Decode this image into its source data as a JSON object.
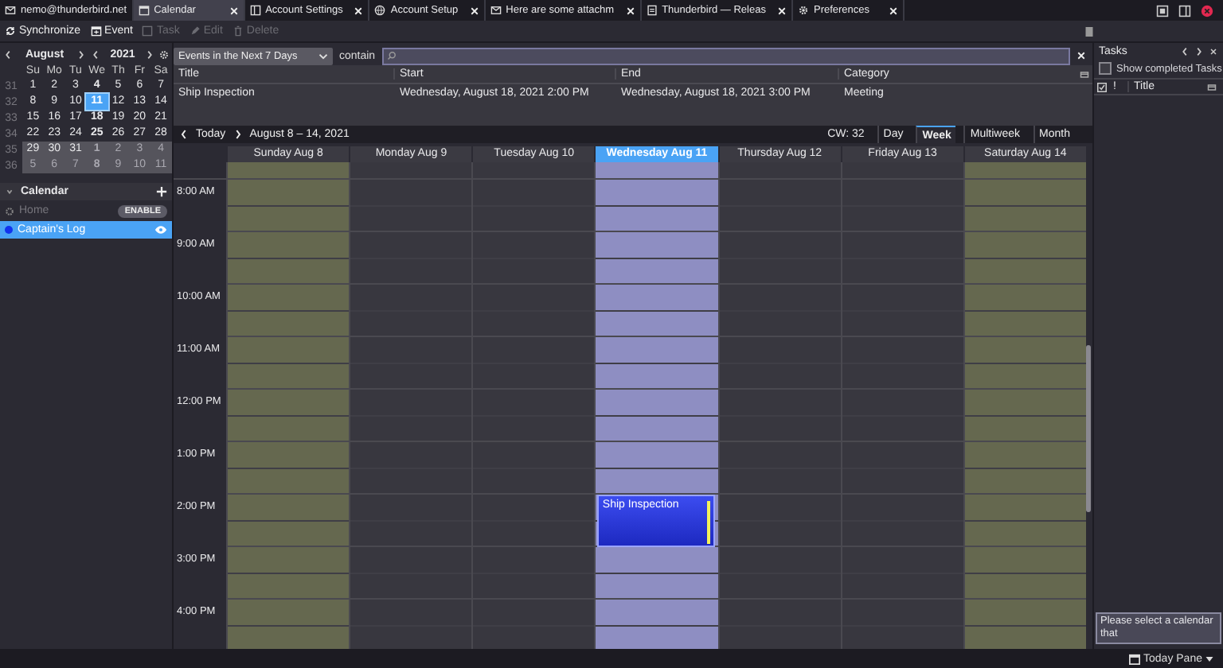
{
  "tabs": [
    {
      "label": "nemo@thunderbird.net",
      "kind": "mail",
      "selected": false,
      "closable": false
    },
    {
      "label": "Calendar",
      "kind": "calendar",
      "selected": true,
      "closable": true
    },
    {
      "label": "Account Settings",
      "kind": "panel",
      "selected": false,
      "closable": true
    },
    {
      "label": "Account Setup",
      "kind": "globe",
      "selected": false,
      "closable": true
    },
    {
      "label": "Here are some attachm",
      "kind": "mail",
      "selected": false,
      "closable": true
    },
    {
      "label": "Thunderbird — Releas",
      "kind": "document",
      "selected": false,
      "closable": true
    },
    {
      "label": "Preferences",
      "kind": "gear",
      "selected": false,
      "closable": true
    }
  ],
  "toolbar": [
    {
      "label": "Synchronize",
      "kind": "sync",
      "disabled": false
    },
    {
      "label": "Event",
      "kind": "calendar",
      "disabled": false
    },
    {
      "label": "Task",
      "kind": "task",
      "disabled": true
    },
    {
      "label": "Edit",
      "kind": "pencil",
      "disabled": true
    },
    {
      "label": "Delete",
      "kind": "trash",
      "disabled": true
    }
  ],
  "minimonth": {
    "month": "August",
    "year": "2021",
    "weekdays": [
      "Su",
      "Mo",
      "Tu",
      "We",
      "Th",
      "Fr",
      "Sa"
    ],
    "weeks": [
      {
        "number": "31",
        "shaded": false,
        "days": [
          {
            "label": "1",
            "other_month": false,
            "has_events": false,
            "selected": false
          },
          {
            "label": "2",
            "other_month": false,
            "has_events": false,
            "selected": false
          },
          {
            "label": "3",
            "other_month": false,
            "has_events": false,
            "selected": false
          },
          {
            "label": "4",
            "other_month": false,
            "has_events": true,
            "selected": false
          },
          {
            "label": "5",
            "other_month": false,
            "has_events": false,
            "selected": false
          },
          {
            "label": "6",
            "other_month": false,
            "has_events": false,
            "selected": false
          },
          {
            "label": "7",
            "other_month": false,
            "has_events": false,
            "selected": false
          }
        ]
      },
      {
        "number": "32",
        "shaded": false,
        "days": [
          {
            "label": "8",
            "other_month": false,
            "has_events": false,
            "selected": false
          },
          {
            "label": "9",
            "other_month": false,
            "has_events": false,
            "selected": false
          },
          {
            "label": "10",
            "other_month": false,
            "has_events": false,
            "selected": false
          },
          {
            "label": "11",
            "other_month": false,
            "has_events": true,
            "selected": true
          },
          {
            "label": "12",
            "other_month": false,
            "has_events": false,
            "selected": false
          },
          {
            "label": "13",
            "other_month": false,
            "has_events": false,
            "selected": false
          },
          {
            "label": "14",
            "other_month": false,
            "has_events": false,
            "selected": false
          }
        ]
      },
      {
        "number": "33",
        "shaded": false,
        "days": [
          {
            "label": "15",
            "other_month": false,
            "has_events": false,
            "selected": false
          },
          {
            "label": "16",
            "other_month": false,
            "has_events": false,
            "selected": false
          },
          {
            "label": "17",
            "other_month": false,
            "has_events": false,
            "selected": false
          },
          {
            "label": "18",
            "other_month": false,
            "has_events": true,
            "selected": false
          },
          {
            "label": "19",
            "other_month": false,
            "has_events": false,
            "selected": false
          },
          {
            "label": "20",
            "other_month": false,
            "has_events": false,
            "selected": false
          },
          {
            "label": "21",
            "other_month": false,
            "has_events": false,
            "selected": false
          }
        ]
      },
      {
        "number": "34",
        "shaded": false,
        "days": [
          {
            "label": "22",
            "other_month": false,
            "has_events": false,
            "selected": false
          },
          {
            "label": "23",
            "other_month": false,
            "has_events": false,
            "selected": false
          },
          {
            "label": "24",
            "other_month": false,
            "has_events": false,
            "selected": false
          },
          {
            "label": "25",
            "other_month": false,
            "has_events": true,
            "selected": false
          },
          {
            "label": "26",
            "other_month": false,
            "has_events": false,
            "selected": false
          },
          {
            "label": "27",
            "other_month": false,
            "has_events": false,
            "selected": false
          },
          {
            "label": "28",
            "other_month": false,
            "has_events": false,
            "selected": false
          }
        ]
      },
      {
        "number": "35",
        "shaded": true,
        "days": [
          {
            "label": "29",
            "other_month": false,
            "has_events": false,
            "selected": false
          },
          {
            "label": "30",
            "other_month": false,
            "has_events": false,
            "selected": false
          },
          {
            "label": "31",
            "other_month": false,
            "has_events": false,
            "selected": false
          },
          {
            "label": "1",
            "other_month": true,
            "has_events": true,
            "selected": false
          },
          {
            "label": "2",
            "other_month": true,
            "has_events": false,
            "selected": false
          },
          {
            "label": "3",
            "other_month": true,
            "has_events": false,
            "selected": false
          },
          {
            "label": "4",
            "other_month": true,
            "has_events": false,
            "selected": false
          }
        ]
      },
      {
        "number": "36",
        "shaded": true,
        "days": [
          {
            "label": "5",
            "other_month": true,
            "has_events": false,
            "selected": false
          },
          {
            "label": "6",
            "other_month": true,
            "has_events": false,
            "selected": false
          },
          {
            "label": "7",
            "other_month": true,
            "has_events": false,
            "selected": false
          },
          {
            "label": "8",
            "other_month": true,
            "has_events": true,
            "selected": false
          },
          {
            "label": "9",
            "other_month": true,
            "has_events": false,
            "selected": false
          },
          {
            "label": "10",
            "other_month": true,
            "has_events": false,
            "selected": false
          },
          {
            "label": "11",
            "other_month": true,
            "has_events": false,
            "selected": false
          }
        ]
      }
    ]
  },
  "calendars": {
    "title": "Calendar",
    "items": [
      {
        "name": "Home",
        "enabled": false,
        "action": "ENABLE",
        "selected": false
      },
      {
        "name": "Captain's Log",
        "enabled": true,
        "selected": true,
        "color": "#1133ee"
      }
    ]
  },
  "filter": {
    "dropdown": "Events in the Next 7 Days",
    "label": "contain"
  },
  "event_list": {
    "columns": [
      "Title",
      "Start",
      "End",
      "Category"
    ],
    "rows": [
      {
        "cells": [
          "Ship Inspection",
          "Wednesday, August 18, 2021 2:00 PM",
          "Wednesday, August 18, 2021 3:00 PM",
          "Meeting"
        ],
        "selected": false
      }
    ]
  },
  "nav": {
    "today": "Today",
    "range": "August 8 – 14, 2021",
    "week": "CW: 32",
    "views": [
      {
        "label": "Day",
        "selected": false
      },
      {
        "label": "Week",
        "selected": true
      },
      {
        "label": "Multiweek",
        "selected": false
      },
      {
        "label": "Month",
        "selected": false
      }
    ]
  },
  "days": [
    {
      "label": "Sunday Aug 8",
      "kind": "sun",
      "selected": false,
      "weekend": true
    },
    {
      "label": "Monday Aug 9",
      "kind": "mon",
      "selected": false,
      "weekend": false
    },
    {
      "label": "Tuesday Aug 10",
      "kind": "tue",
      "selected": false,
      "weekend": false
    },
    {
      "label": "Wednesday Aug 11",
      "kind": "wed",
      "selected": true,
      "weekend": false
    },
    {
      "label": "Thursday Aug 12",
      "kind": "thu",
      "selected": false,
      "weekend": false
    },
    {
      "label": "Friday Aug 13",
      "kind": "fri",
      "selected": false,
      "weekend": false
    },
    {
      "label": "Saturday Aug 14",
      "kind": "sat",
      "selected": false,
      "weekend": true
    }
  ],
  "times": [
    {
      "label": "8:00 AM"
    },
    {
      "label": "9:00 AM"
    },
    {
      "label": "10:00 AM"
    },
    {
      "label": "11:00 AM"
    },
    {
      "label": "12:00 PM"
    },
    {
      "label": "1:00 PM"
    },
    {
      "label": "2:00 PM",
      "events": [
        {
          "title": "Ship Inspection",
          "kind": "wed"
        }
      ]
    },
    {
      "label": "3:00 PM"
    },
    {
      "label": "4:00 PM"
    }
  ],
  "tasks": {
    "title": "Tasks",
    "show_completed": {
      "label": "Show completed Tasks",
      "checked": false
    },
    "columns": [
      "!",
      "Title"
    ],
    "message": "Please select a calendar that"
  },
  "status_bar": {
    "today_pane": "Today Pane"
  }
}
